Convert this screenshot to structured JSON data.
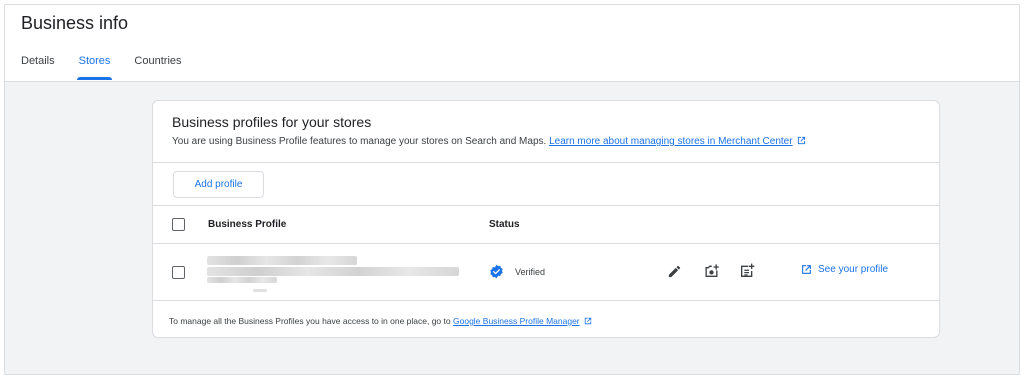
{
  "page": {
    "title": "Business info",
    "tabs": [
      {
        "label": "Details",
        "active": false
      },
      {
        "label": "Stores",
        "active": true
      },
      {
        "label": "Countries",
        "active": false
      }
    ]
  },
  "card": {
    "title": "Business profiles for your stores",
    "description": "You are using Business Profile features to manage your stores on Search and Maps.",
    "learn_more_link": "Learn more about managing stores in Merchant Center",
    "add_profile_label": "Add profile",
    "table": {
      "columns": [
        "Business Profile",
        "Status"
      ],
      "rows": [
        {
          "profile": "",
          "status": "Verified",
          "see_profile_label": "See your profile"
        }
      ]
    },
    "footer_text": "To manage all the Business Profiles you have access to in one place, go to",
    "footer_link": "Google Business Profile Manager"
  },
  "colors": {
    "accent": "#1a73e8",
    "border": "#dadce0",
    "page_bg": "#f1f3f4"
  },
  "icons": [
    "external-link-icon",
    "verified-badge-icon",
    "edit-pencil-icon",
    "add-photo-icon",
    "add-post-icon"
  ]
}
